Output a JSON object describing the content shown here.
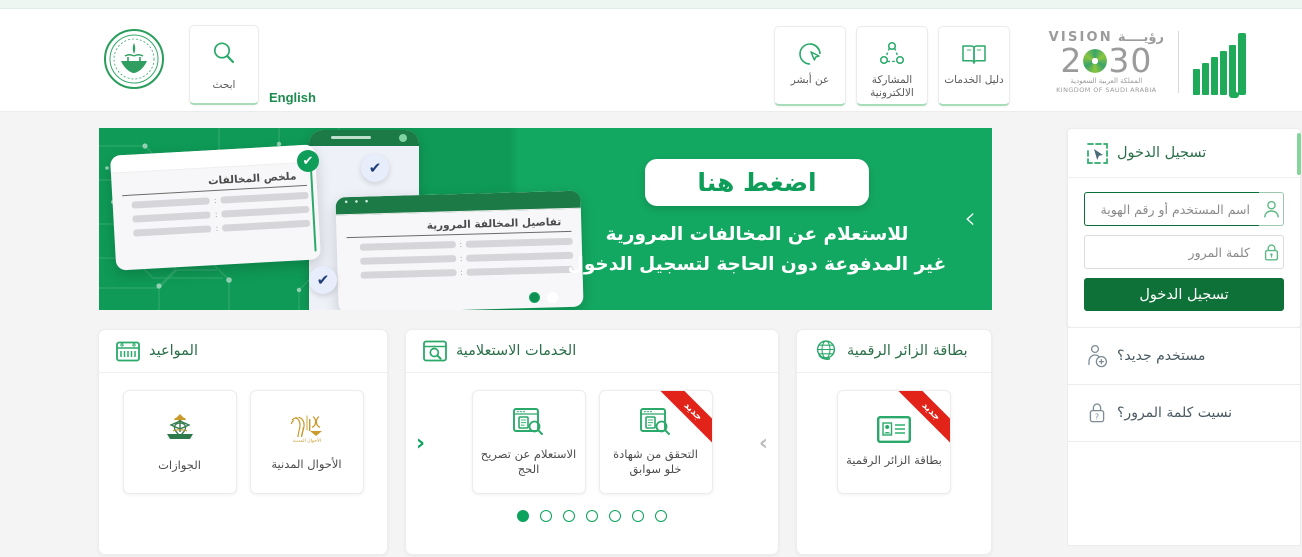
{
  "header": {
    "emblem_name": "ministry-of-interior-emblem",
    "search": {
      "label": "ابحث",
      "icon": "search-icon"
    },
    "english_link": "English",
    "nav_cards": [
      {
        "label": "دليل الخدمات",
        "icon": "book-icon"
      },
      {
        "label": "المشاركة الالكترونية",
        "icon": "network-share-icon"
      },
      {
        "label": "عن أبشر",
        "icon": "cursor-circle-icon"
      }
    ],
    "vision": {
      "word_en": "VISION",
      "word_ar": "رؤيــــة",
      "number_left": "2",
      "number_right": "30",
      "sub_ar": "المملكة العربية السعودية",
      "sub_en": "KINGDOM OF SAUDI ARABIA"
    },
    "absher_logo_name": "absher-logo"
  },
  "banner": {
    "button_label": "اضغط هنا",
    "text_line1": "للاستعلام عن المخالفات المرورية",
    "text_line2": "غير المدفوعة دون الحاجة لتسجيل الدخول",
    "next_arrow": "›",
    "mock_card_1_title": "ملخص المخالفات",
    "mock_card_2_title": "تفاصيل المخالفة المرورية",
    "separator": ":",
    "check_glyph": "✔",
    "dots": [
      {
        "state": "on"
      },
      {
        "state": "off"
      }
    ]
  },
  "panels": {
    "appointments": {
      "title": "المواعيد",
      "icon": "calendar-icon",
      "tiles": [
        {
          "label": "الأحوال المدنية",
          "icon": "civil-affairs-logo",
          "ribbon": null
        },
        {
          "label": "الجوازات",
          "icon": "passports-logo",
          "ribbon": null
        }
      ]
    },
    "inquiry": {
      "title": "الخدمات الاستعلامية",
      "icon": "browser-search-icon",
      "arrow_prev": "‹",
      "arrow_next": "›",
      "tiles": [
        {
          "label": "التحقق من شهادة خلو سوابق",
          "icon": "document-search-icon",
          "ribbon": "جديد"
        },
        {
          "label": "الاستعلام عن تصريح الحج",
          "icon": "document-search-icon",
          "ribbon": null
        }
      ],
      "dots": [
        {
          "state": "on"
        },
        {
          "state": "off"
        },
        {
          "state": "off"
        },
        {
          "state": "off"
        },
        {
          "state": "off"
        },
        {
          "state": "off"
        },
        {
          "state": "off"
        }
      ]
    },
    "visitor": {
      "title": "بطاقة الزائر الرقمية",
      "icon": "globe-icon",
      "tiles": [
        {
          "label": "بطاقة الزائر الرقمية",
          "icon": "id-card-icon",
          "ribbon": "جديد"
        }
      ]
    }
  },
  "login": {
    "title": "تسجيل الدخول",
    "title_icon": "cursor-select-icon",
    "username": {
      "placeholder": "اسم المستخدم أو رقم الهوية",
      "value": "",
      "icon": "user-icon",
      "focused": true
    },
    "password": {
      "placeholder": "كلمة المرور",
      "value": "",
      "icon": "lock-icon"
    },
    "submit_label": "تسجيل الدخول",
    "links": [
      {
        "label": "مستخدم جديد؟",
        "icon": "add-user-icon"
      },
      {
        "label": "نسيت كلمة المرور؟",
        "icon": "lock-question-icon"
      }
    ]
  },
  "colors": {
    "brand_green": "#0e9e59",
    "dark_green": "#0d7138",
    "title_green": "#2b6f49",
    "accent_light_green": "#86d49b",
    "ribbon_red": "#e2231a",
    "page_bg": "#f4f4f4"
  }
}
